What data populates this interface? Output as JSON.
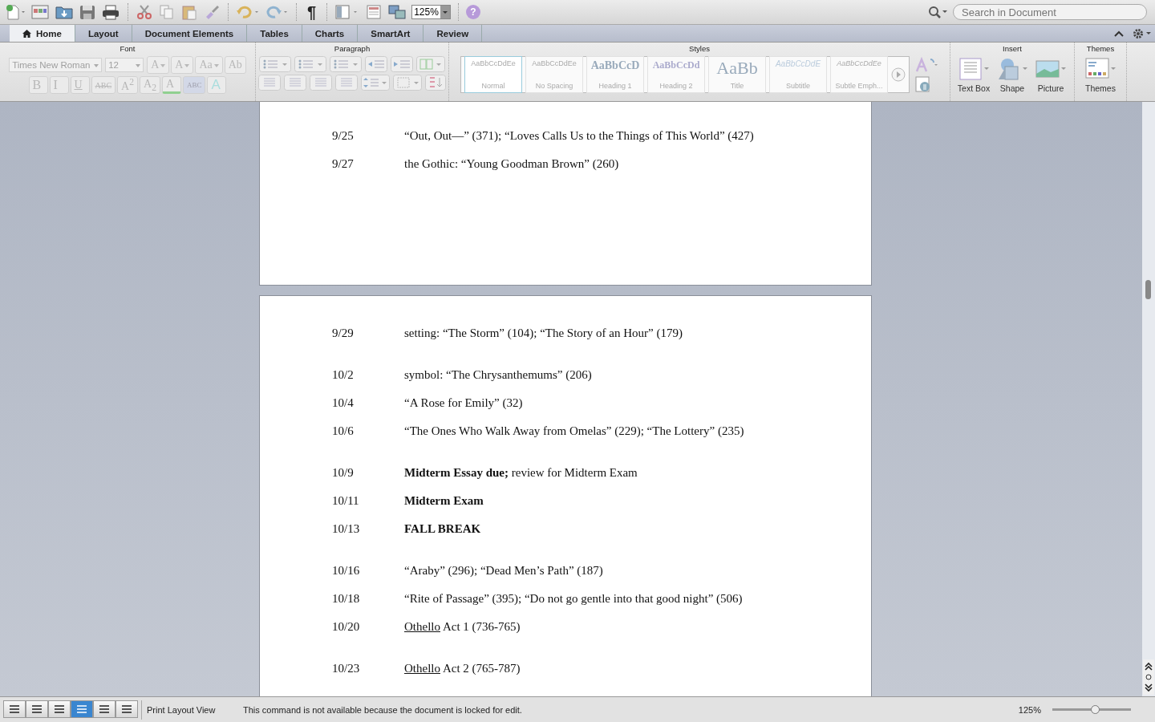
{
  "toolbar": {
    "pilcrow": "¶",
    "zoom": "125%",
    "help": "?",
    "search": {
      "placeholder": "Search in Document"
    }
  },
  "tabs": [
    {
      "label": "Home",
      "selected": true
    },
    {
      "label": "Layout",
      "selected": false
    },
    {
      "label": "Document Elements",
      "selected": false
    },
    {
      "label": "Tables",
      "selected": false
    },
    {
      "label": "Charts",
      "selected": false
    },
    {
      "label": "SmartArt",
      "selected": false
    },
    {
      "label": "Review",
      "selected": false
    }
  ],
  "ribbon": {
    "disabled": true,
    "font": {
      "title": "Font",
      "font_name": "Times New Roman",
      "font_size": "12",
      "row1": [
        "A",
        "A",
        "Aa",
        "Ab"
      ],
      "row2": [
        "B",
        "I",
        "U",
        "ABC",
        "A$^{2}$",
        "A$_{2}$",
        "A",
        "ABC",
        "A"
      ]
    },
    "paragraph": {
      "title": "Paragraph"
    },
    "styles": {
      "title": "Styles",
      "items": [
        {
          "sample": "AaBbCcDdEe",
          "name": "Normal",
          "selected": true
        },
        {
          "sample": "AaBbCcDdEe",
          "name": "No Spacing",
          "selected": false
        },
        {
          "sample": "AaBbCcD",
          "name": "Heading 1",
          "selected": false
        },
        {
          "sample": "AaBbCcDd",
          "name": "Heading 2",
          "selected": false
        },
        {
          "sample": "AaBb",
          "name": "Title",
          "selected": false
        },
        {
          "sample": "AaBbCcDdE",
          "name": "Subtitle",
          "selected": false
        },
        {
          "sample": "AaBbCcDdEe",
          "name": "Subtle Emph...",
          "selected": false
        }
      ]
    },
    "insert": {
      "title": "Insert",
      "items": [
        "Text Box",
        "Shape",
        "Picture"
      ]
    },
    "themes": {
      "title": "Themes",
      "label": "Themes"
    }
  },
  "pages": [
    {
      "weeks": [
        [
          {
            "date": "9/25",
            "text": "“Out, Out—” (371); “Loves Calls Us to the Things of This World” (427)",
            "bold": false
          },
          {
            "date": "9/27",
            "text": "the Gothic:  “Young Goodman Brown” (260)",
            "bold": false
          }
        ]
      ]
    },
    {
      "weeks": [
        [
          {
            "date": "9/29",
            "text": "setting:  “The Storm” (104); “The Story of an Hour” (179)",
            "bold": false
          }
        ],
        [
          {
            "date": "10/2",
            "text": "symbol:  “The Chrysanthemums” (206)",
            "bold": false
          },
          {
            "date": "10/4",
            "text": "“A Rose for Emily” (32)",
            "bold": false
          },
          {
            "date": "10/6",
            "text": "“The Ones Who Walk Away from Omelas” (229); “The Lottery” (235)",
            "bold": false
          }
        ],
        [
          {
            "date": "10/9",
            "text": "**Midterm Essay due;** review for Midterm Exam",
            "bold": false
          },
          {
            "date": "10/11",
            "text": "Midterm Exam",
            "bold": true
          },
          {
            "date": "10/13",
            "text": "FALL BREAK",
            "bold": true
          }
        ],
        [
          {
            "date": "10/16",
            "text": "“Araby” (296); “Dead Men’s Path” (187)",
            "bold": false
          },
          {
            "date": "10/18",
            "text": "“Rite of Passage” (395); “Do not go gentle into that good night” (506)",
            "bold": false
          },
          {
            "date": "10/20",
            "title": "Othello",
            "text": " Act 1 (736-765)",
            "bold": false
          }
        ],
        [
          {
            "date": "10/23",
            "title": "Othello",
            "text": " Act 2 (765-787)",
            "bold": false
          }
        ]
      ]
    }
  ],
  "status_bar": {
    "views": [
      {
        "selected": false
      },
      {
        "selected": false
      },
      {
        "selected": false
      },
      {
        "selected": true
      },
      {
        "selected": false
      },
      {
        "selected": false
      }
    ],
    "view_name": "Print Layout View",
    "message": "This command is not available because the document is locked for edit.",
    "zoom": "125%",
    "zoom_slider": {
      "level": 0.54
    }
  }
}
